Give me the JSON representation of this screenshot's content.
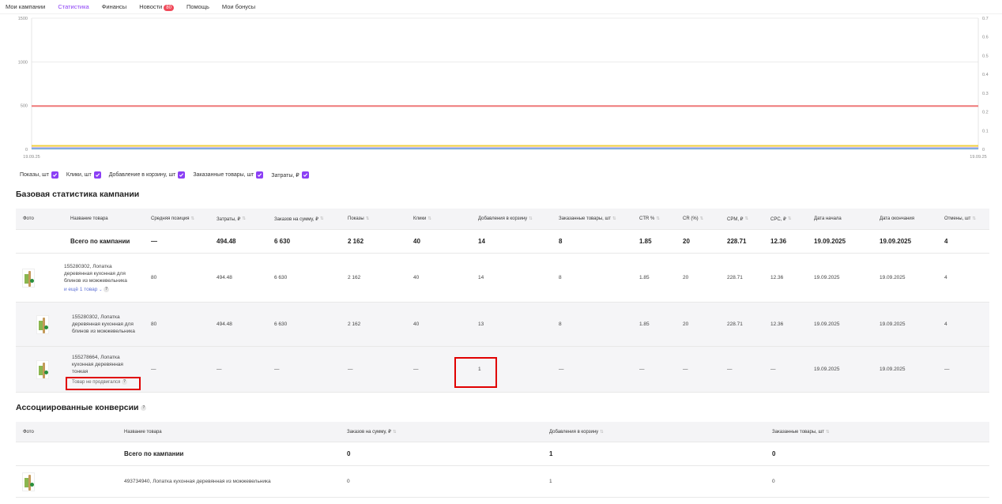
{
  "nav": {
    "items": [
      {
        "label": "Мои кампании",
        "active": false
      },
      {
        "label": "Статистика",
        "active": true
      },
      {
        "label": "Финансы",
        "active": false
      },
      {
        "label": "Новости",
        "active": false,
        "badge": "80"
      },
      {
        "label": "Помощь",
        "active": false
      },
      {
        "label": "Мои бонусы",
        "active": false
      }
    ]
  },
  "chart_data": {
    "type": "line",
    "x": [
      "19.09.25",
      "19.09.25"
    ],
    "y_left_ticks": [
      "1500",
      "1000",
      "500",
      "0"
    ],
    "y_right_ticks": [
      "0.7",
      "0.6",
      "0.5",
      "0.4",
      "0.3",
      "0.2",
      "0.1",
      "0"
    ],
    "ylim_left": [
      0,
      1500
    ],
    "ylim_right": [
      0,
      0.7
    ],
    "series": [
      {
        "name": "Затраты, ₽",
        "color": "#f07a7a",
        "values": [
          494.48,
          494.48
        ]
      },
      {
        "name": "Показы, шт",
        "color": "#f0d040",
        "values": [
          40,
          40
        ]
      },
      {
        "name": "Клики, шт",
        "color": "#b080e0",
        "values": [
          14,
          14
        ]
      },
      {
        "name": "Добавление в корзину, шт",
        "color": "#7fb0e0",
        "values": [
          8,
          8
        ]
      }
    ]
  },
  "legend": [
    {
      "label": "Показы, шт"
    },
    {
      "label": "Клики, шт"
    },
    {
      "label": "Добавление в корзину, шт"
    },
    {
      "label": "Заказанные товары, шт"
    },
    {
      "label": "Затраты, ₽"
    }
  ],
  "colors": {
    "accent": "#8b3ff5",
    "highlight": "#e00000"
  },
  "base": {
    "title": "Базовая статистика кампании",
    "headers": [
      "Фото",
      "Название товара",
      "Средняя позиция",
      "Затраты, ₽",
      "Заказов на сумму, ₽",
      "Показы",
      "Клики",
      "Добавления в корзину",
      "Заказанные товары, шт",
      "CTR %",
      "CR (%)",
      "CPM, ₽",
      "CPC, ₽",
      "Дата начала",
      "Дата окончания",
      "Отмены, шт"
    ],
    "total": {
      "label": "Всего по кампании",
      "values": [
        "—",
        "494.48",
        "6 630",
        "2 162",
        "40",
        "14",
        "8",
        "1.85",
        "20",
        "228.71",
        "12.36",
        "19.09.2025",
        "19.09.2025",
        "4"
      ]
    },
    "rows": [
      {
        "name": "155280302, Лопатка деревянная кухонная для блинов из можжевельника",
        "extra": "и ещё 1 товар",
        "values": [
          "80",
          "494.48",
          "6 630",
          "2 162",
          "40",
          "14",
          "8",
          "1.85",
          "20",
          "228.71",
          "12.36",
          "19.09.2025",
          "19.09.2025",
          "4"
        ]
      },
      {
        "name": "155280302, Лопатка деревянная кухонная для блинов из можжевельника",
        "values": [
          "80",
          "494.48",
          "6 630",
          "2 162",
          "40",
          "13",
          "8",
          "1.85",
          "20",
          "228.71",
          "12.36",
          "19.09.2025",
          "19.09.2025",
          "4"
        ]
      },
      {
        "name": "155278664, Лопатка кухонная деревянная тонкая",
        "note": "Товар не продвигался",
        "values": [
          "—",
          "—",
          "—",
          "—",
          "—",
          "1",
          "—",
          "—",
          "—",
          "—",
          "—",
          "19.09.2025",
          "19.09.2025",
          "—"
        ]
      }
    ]
  },
  "assoc": {
    "title": "Ассоциированные конверсии",
    "headers": [
      "Фото",
      "Название товара",
      "Заказов на сумму, ₽",
      "Добавления в корзину",
      "Заказанные товары, шт"
    ],
    "total": {
      "label": "Всего по кампании",
      "values": [
        "0",
        "1",
        "0"
      ]
    },
    "rows": [
      {
        "name": "493734940, Лопатка кухонная деревянная из можжевельника",
        "values": [
          "0",
          "1",
          "0"
        ]
      }
    ]
  }
}
